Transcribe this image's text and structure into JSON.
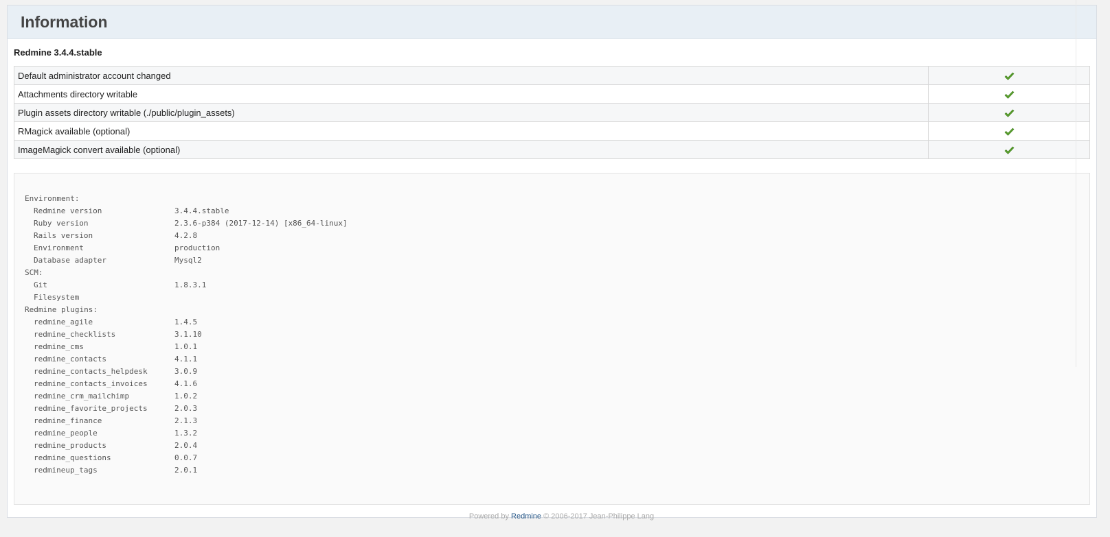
{
  "header": {
    "title": "Information"
  },
  "version_heading": "Redmine 3.4.4.stable",
  "checks": [
    {
      "label": "Default administrator account changed",
      "status": "ok"
    },
    {
      "label": "Attachments directory writable",
      "status": "ok"
    },
    {
      "label": "Plugin assets directory writable (./public/plugin_assets)",
      "status": "ok"
    },
    {
      "label": "RMagick available (optional)",
      "status": "ok"
    },
    {
      "label": "ImageMagick convert available (optional)",
      "status": "ok"
    }
  ],
  "check_color": "#5aa02c",
  "environment": {
    "heading": "Environment:",
    "rows": [
      {
        "key": "Redmine version",
        "value": "3.4.4.stable"
      },
      {
        "key": "Ruby version",
        "value": "2.3.6-p384 (2017-12-14) [x86_64-linux]"
      },
      {
        "key": "Rails version",
        "value": "4.2.8"
      },
      {
        "key": "Environment",
        "value": "production"
      },
      {
        "key": "Database adapter",
        "value": "Mysql2"
      }
    ]
  },
  "scm": {
    "heading": "SCM:",
    "rows": [
      {
        "key": "Git",
        "value": "1.8.3.1"
      },
      {
        "key": "Filesystem",
        "value": ""
      }
    ]
  },
  "plugins": {
    "heading": "Redmine plugins:",
    "rows": [
      {
        "key": "redmine_agile",
        "value": "1.4.5"
      },
      {
        "key": "redmine_checklists",
        "value": "3.1.10"
      },
      {
        "key": "redmine_cms",
        "value": "1.0.1"
      },
      {
        "key": "redmine_contacts",
        "value": "4.1.1"
      },
      {
        "key": "redmine_contacts_helpdesk",
        "value": "3.0.9"
      },
      {
        "key": "redmine_contacts_invoices",
        "value": "4.1.6"
      },
      {
        "key": "redmine_crm_mailchimp",
        "value": "1.0.2"
      },
      {
        "key": "redmine_favorite_projects",
        "value": "2.0.3"
      },
      {
        "key": "redmine_finance",
        "value": "2.1.3"
      },
      {
        "key": "redmine_people",
        "value": "1.3.2"
      },
      {
        "key": "redmine_products",
        "value": "2.0.4"
      },
      {
        "key": "redmine_questions",
        "value": "0.0.7"
      },
      {
        "key": "redmineup_tags",
        "value": "2.0.1"
      }
    ]
  },
  "footer": {
    "prefix": "Powered by",
    "link": "Redmine",
    "suffix": "© 2006-2017 Jean-Philippe Lang"
  }
}
